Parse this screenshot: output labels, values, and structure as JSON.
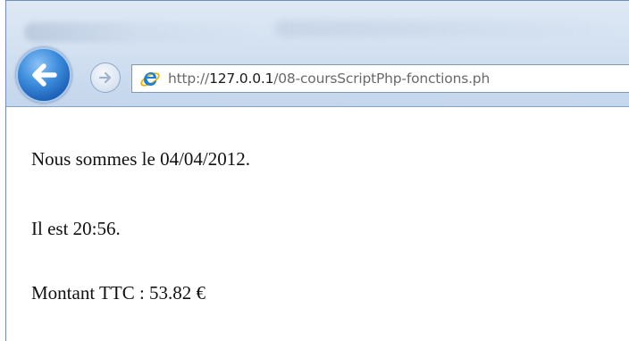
{
  "browser": {
    "address_bar": {
      "protocol": "http://",
      "host": "127.0.0.1",
      "path": "/08-coursScriptPhp-fonctions.ph"
    },
    "icons": {
      "back": "back-arrow-icon",
      "forward": "forward-arrow-icon",
      "page": "internet-explorer-icon"
    },
    "colors": {
      "back_button": "#2a78cf",
      "chrome": "#d3e1f1"
    }
  },
  "page": {
    "lines": [
      "Nous sommes le 04/04/2012.",
      "Il est 20:56.",
      "Montant TTC : 53.82 €"
    ]
  }
}
